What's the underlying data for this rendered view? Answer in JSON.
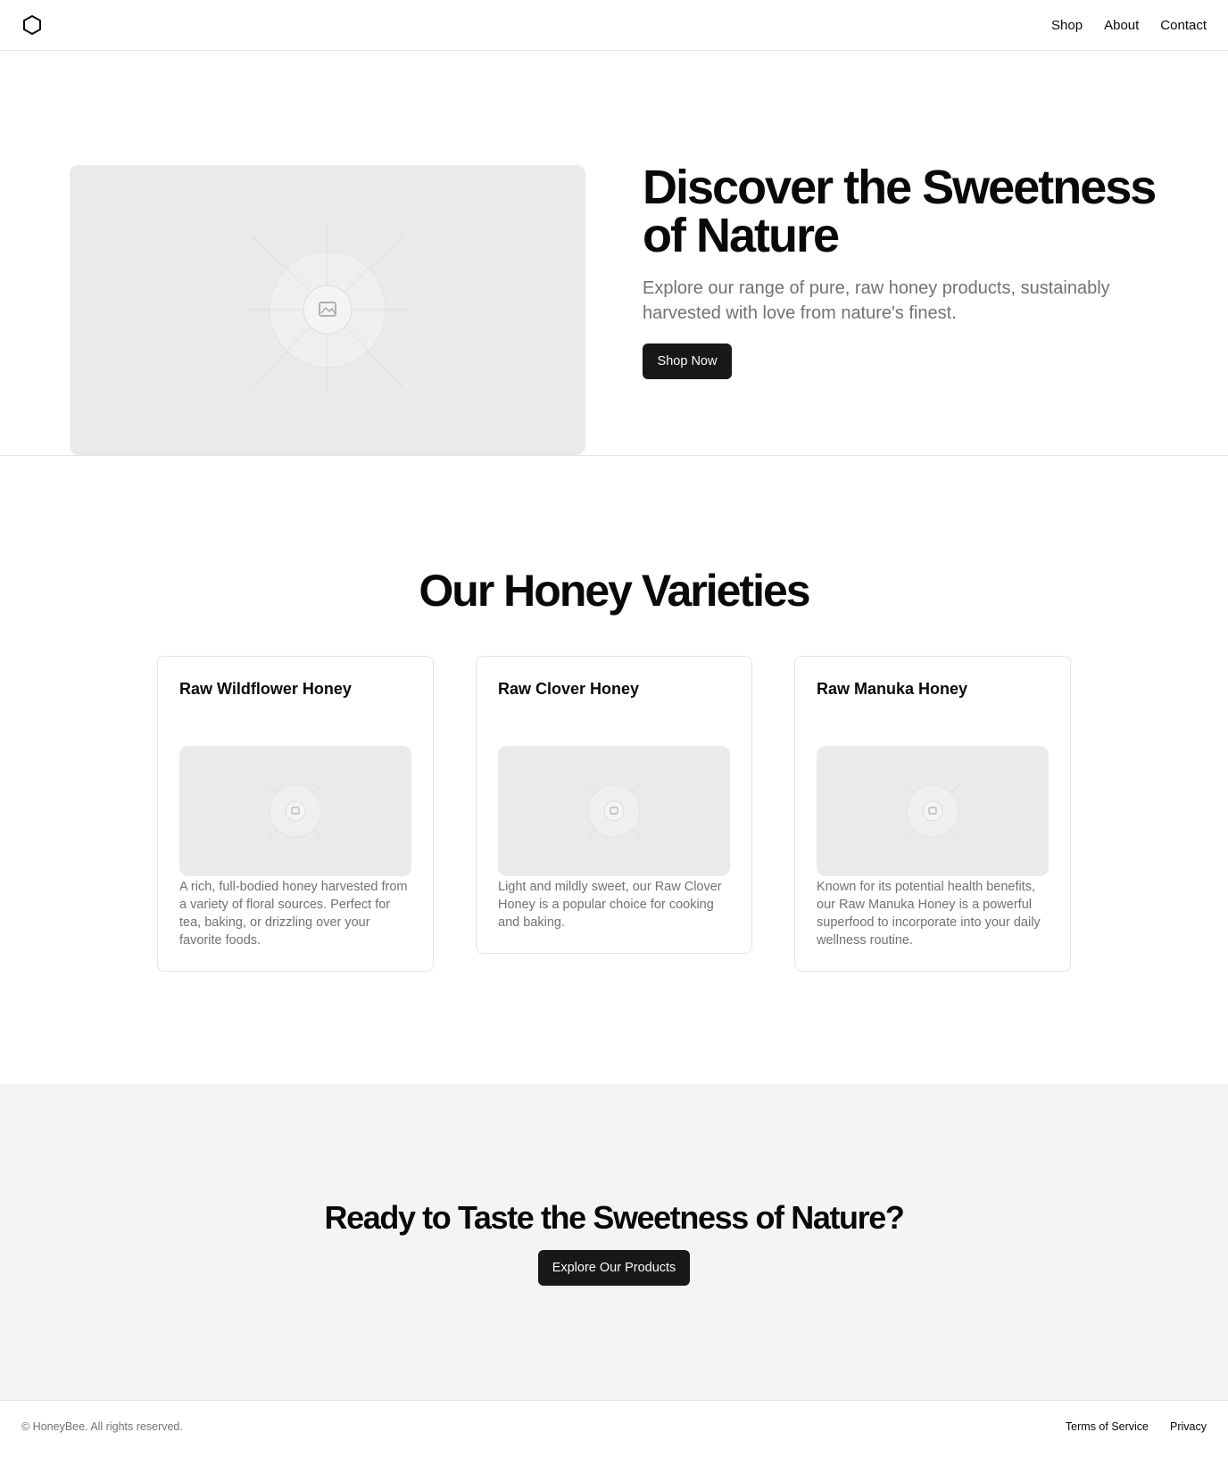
{
  "header": {
    "logo_icon": "hexagon-icon",
    "nav": [
      {
        "label": "Shop"
      },
      {
        "label": "About"
      },
      {
        "label": "Contact"
      }
    ]
  },
  "hero": {
    "image_icon": "image-placeholder-icon",
    "title": "Discover the Sweetness of Nature",
    "subtitle": "Explore our range of pure, raw honey products, sustainably harvested with love from nature's finest.",
    "button_label": "Shop Now"
  },
  "varieties": {
    "title": "Our Honey Varieties",
    "cards": [
      {
        "title": "Raw Wildflower Honey",
        "description": "A rich, full-bodied honey harvested from a variety of floral sources. Perfect for tea, baking, or drizzling over your favorite foods."
      },
      {
        "title": "Raw Clover Honey",
        "description": "Light and mildly sweet, our Raw Clover Honey is a popular choice for cooking and baking."
      },
      {
        "title": "Raw Manuka Honey",
        "description": "Known for its potential health benefits, our Raw Manuka Honey is a powerful superfood to incorporate into your daily wellness routine."
      }
    ]
  },
  "cta": {
    "title": "Ready to Taste the Sweetness of Nature?",
    "button_label": "Explore Our Products"
  },
  "footer": {
    "copyright": "© HoneyBee. All rights reserved.",
    "links": [
      {
        "label": "Terms of Service"
      },
      {
        "label": "Privacy"
      }
    ]
  },
  "colors": {
    "primary": "#18181b",
    "muted_text": "#71717a",
    "placeholder_bg": "#eaeaea",
    "cta_bg": "#f4f4f5",
    "border": "#e4e4e7"
  }
}
